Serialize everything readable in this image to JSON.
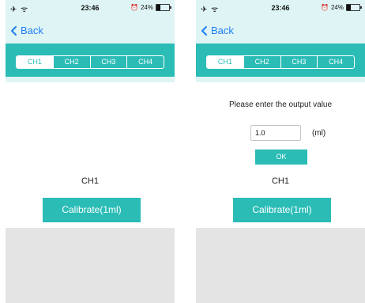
{
  "screens": [
    {
      "status": {
        "signal": "✈ ᯤ",
        "time": "23:46",
        "battery": "24%"
      },
      "nav": {
        "back_label": "Back"
      },
      "tabs": [
        {
          "label": "CH1",
          "selected": true
        },
        {
          "label": "CH2",
          "selected": false
        },
        {
          "label": "CH3",
          "selected": false
        },
        {
          "label": "CH4",
          "selected": false
        }
      ],
      "channel_label": "CH1",
      "calibrate_label": "Calibrate(1ml)"
    },
    {
      "status": {
        "signal": "✈ ᯤ",
        "time": "23:46",
        "battery": "24%"
      },
      "nav": {
        "back_label": "Back"
      },
      "tabs": [
        {
          "label": "CH1",
          "selected": true
        },
        {
          "label": "CH2",
          "selected": false
        },
        {
          "label": "CH3",
          "selected": false
        },
        {
          "label": "CH4",
          "selected": false
        }
      ],
      "prompt": "Please enter the output value",
      "input_value": "1.0",
      "unit": "(ml)",
      "ok_label": "OK",
      "channel_label": "CH1",
      "calibrate_label": "Calibrate(1ml)"
    }
  ],
  "colors": {
    "accent": "#2bbcb6",
    "header_bg": "#dff5f5",
    "link": "#1e7ef2",
    "panel": "#e4e4e4"
  },
  "icons": {
    "back": "chevron-left-icon",
    "alarm": "alarm-icon",
    "battery": "battery-icon",
    "airplane": "airplane-icon",
    "wifi": "wifi-icon"
  }
}
